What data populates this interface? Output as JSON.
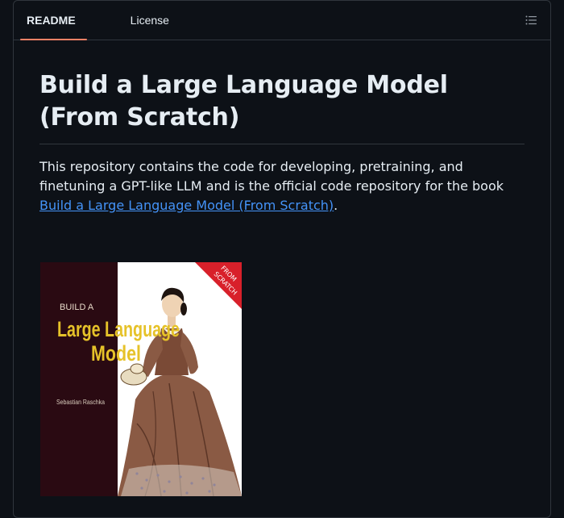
{
  "tabs": {
    "readme": "README",
    "license": "License"
  },
  "readme": {
    "title": "Build a Large Language Model (From Scratch)",
    "desc_before": "This repository contains the code for developing, pretraining, and finetuning a GPT-like LLM and is the official code repository for the book ",
    "link_text": "Build a Large Language Model (From Scratch)",
    "desc_after": "."
  },
  "cover": {
    "build_a": "BUILD A",
    "title_line1": "Large Language",
    "title_line2": "Model",
    "author": "Sebastian Raschka",
    "banner_line1": "FROM",
    "banner_line2": "SCRATCH",
    "colors": {
      "left_panel": "#2a0a12",
      "title_yellow": "#e6c229",
      "banner_red": "#d8202a",
      "right_bg": "#ffffff"
    }
  },
  "colors": {
    "background": "#0d1117",
    "border": "#30363d",
    "text": "#e6edf3",
    "link": "#4493f8",
    "tab_underline": "#f78166"
  },
  "icons": {
    "outline": "list-unordered-icon"
  }
}
